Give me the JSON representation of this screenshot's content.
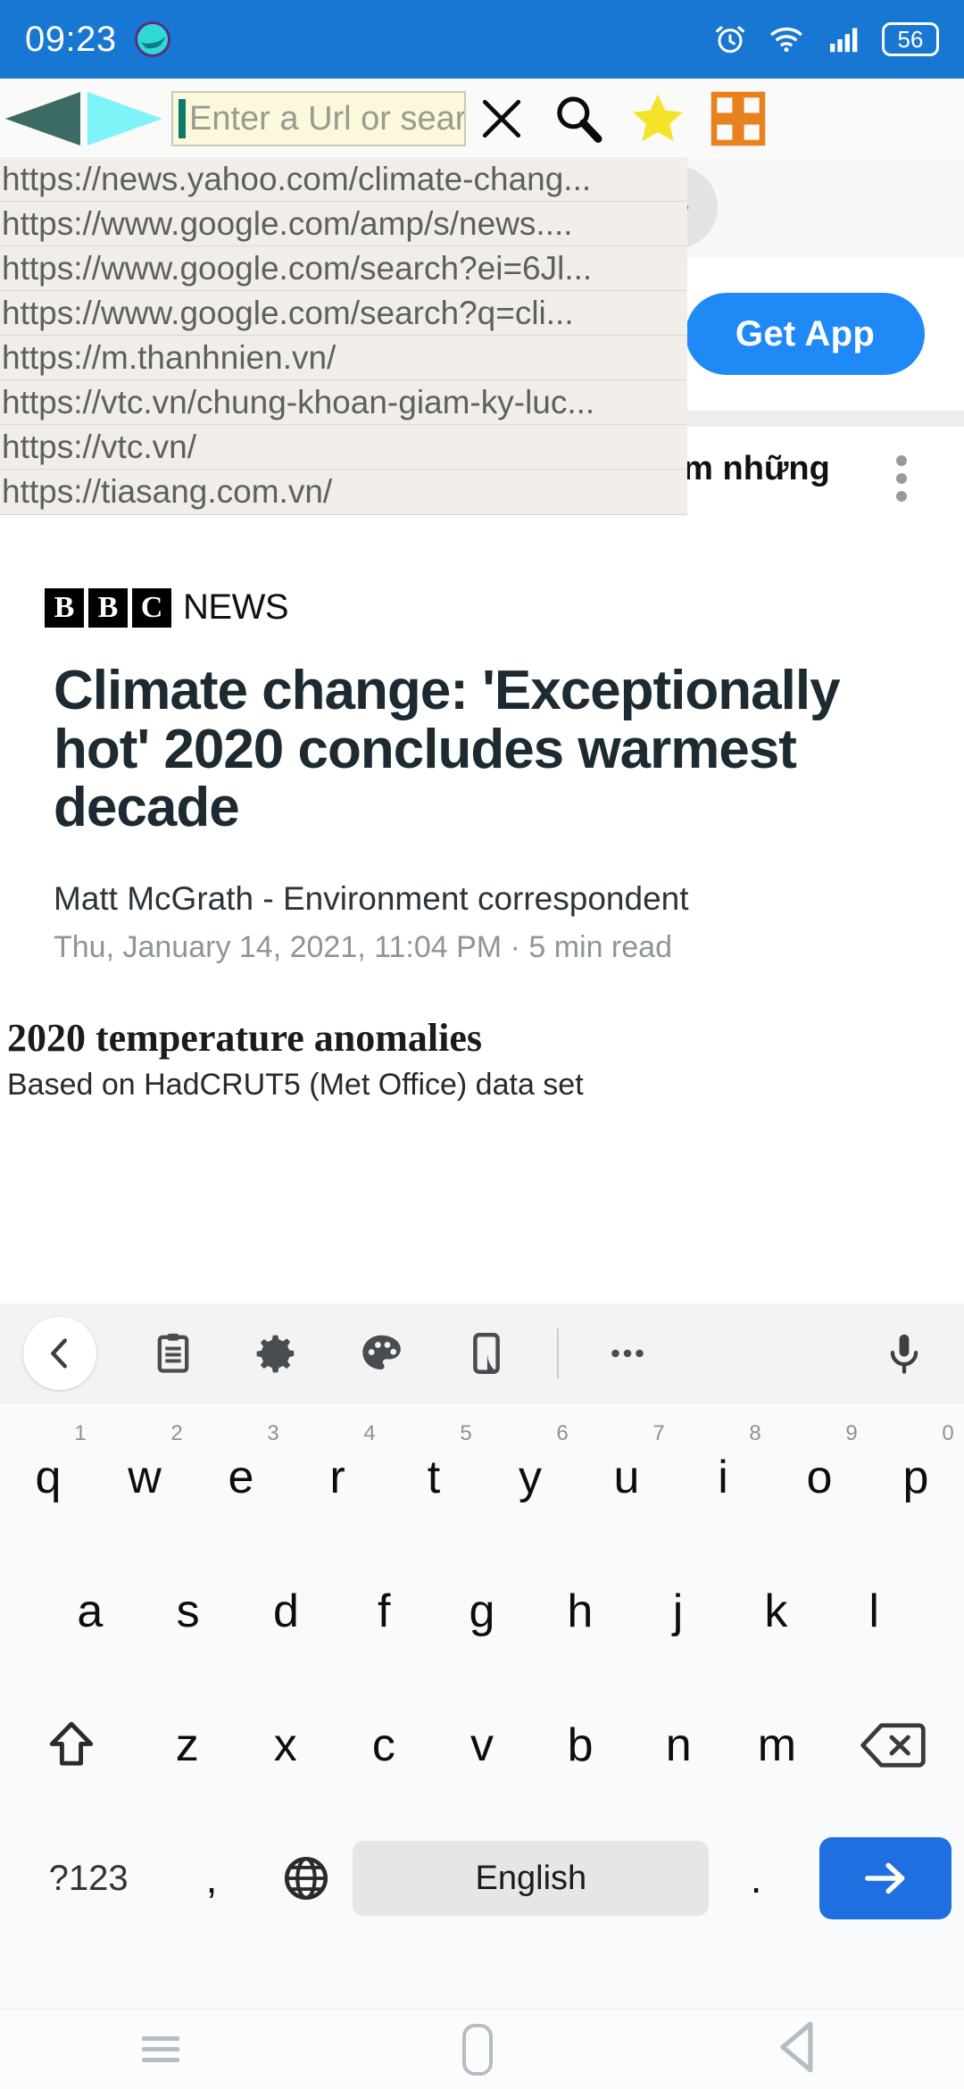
{
  "status_bar": {
    "time": "09:23",
    "battery_level": "56",
    "icons": [
      "app-notification-icon",
      "alarm-icon",
      "wifi-icon",
      "signal-icon",
      "battery-icon"
    ]
  },
  "browser_toolbar": {
    "back_label": "back-arrow",
    "forward_label": "forward-arrow",
    "url_placeholder": "Enter a Url or search with Goog",
    "url_value": "",
    "buttons": [
      {
        "name": "close-icon",
        "label": "X"
      },
      {
        "name": "search-icon",
        "label": "Search"
      },
      {
        "name": "bookmark-star-icon",
        "label": "Bookmarks"
      },
      {
        "name": "tabs-grid-icon",
        "label": "Tabs"
      }
    ]
  },
  "url_suggestions": [
    "https://news.yahoo.com/climate-chang...",
    "https://www.google.com/amp/s/news....",
    "https://www.google.com/search?ei=6Jl...",
    "https://www.google.com/search?q=cli...",
    "https://m.thanhnien.vn/",
    "https://vtc.vn/chung-khoan-giam-ky-luc...",
    "https://vtc.vn/",
    "https://tiasang.com.vn/"
  ],
  "page": {
    "new_tab_label": "+",
    "get_app_label": "Get App",
    "vietnamese_card_text": "àm những",
    "brand": {
      "blocks": [
        "B",
        "B",
        "C"
      ],
      "word": "NEWS"
    },
    "headline": "Climate change: 'Exceptionally hot' 2020 concludes warmest decade",
    "byline": "Matt McGrath - Environment correspondent",
    "meta": "Thu, January 14, 2021, 11:04 PM  ·  5 min read",
    "chart_title": "2020 temperature anomalies",
    "chart_subtitle": "Based on HadCRUT5 (Met Office) data set"
  },
  "keyboard": {
    "toolbar_icons": [
      {
        "name": "back-chevron-icon"
      },
      {
        "name": "clipboard-icon"
      },
      {
        "name": "settings-gear-icon"
      },
      {
        "name": "theme-palette-icon"
      },
      {
        "name": "one-handed-mode-icon"
      },
      {
        "name": "divider"
      },
      {
        "name": "more-options-icon"
      },
      {
        "name": "microphone-icon"
      }
    ],
    "row1": [
      {
        "letter": "q",
        "num": "1"
      },
      {
        "letter": "w",
        "num": "2"
      },
      {
        "letter": "e",
        "num": "3"
      },
      {
        "letter": "r",
        "num": "4"
      },
      {
        "letter": "t",
        "num": "5"
      },
      {
        "letter": "y",
        "num": "6"
      },
      {
        "letter": "u",
        "num": "7"
      },
      {
        "letter": "i",
        "num": "8"
      },
      {
        "letter": "o",
        "num": "9"
      },
      {
        "letter": "p",
        "num": "0"
      }
    ],
    "row2": [
      "a",
      "s",
      "d",
      "f",
      "g",
      "h",
      "j",
      "k",
      "l"
    ],
    "row3": [
      "z",
      "x",
      "c",
      "v",
      "b",
      "n",
      "m"
    ],
    "shift_label": "shift-icon",
    "backspace_label": "backspace-icon",
    "symbols_label": "?123",
    "comma_label": ",",
    "globe_label": "language-globe-icon",
    "space_label": "English",
    "period_label": ".",
    "enter_label": "enter-arrow-icon"
  },
  "nav_bar": {
    "recent_label": "recent-apps",
    "home_label": "home",
    "back_label": "back"
  },
  "colors": {
    "status_bar_bg": "#1877d2",
    "accent_blue": "#1f8af5",
    "url_field_bg": "#fbf8dc",
    "dropdown_bg": "#f1eeea",
    "star_yellow": "#f5e32a",
    "tabs_orange": "#e8821e",
    "enter_blue": "#1f6fe0"
  }
}
